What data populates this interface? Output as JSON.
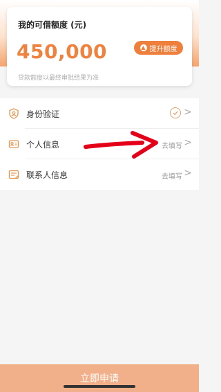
{
  "card": {
    "title": "我的可借额度 (元)",
    "amount": "450,000",
    "raise_button": "提升额度",
    "note": "贷款额度以最终审批结果为准"
  },
  "items": [
    {
      "label": "身份验证",
      "status": "",
      "completed": true,
      "icon": "shield-person-icon"
    },
    {
      "label": "个人信息",
      "status": "去填写",
      "completed": false,
      "icon": "id-card-icon"
    },
    {
      "label": "联系人信息",
      "status": "去填写",
      "completed": false,
      "icon": "contact-card-icon"
    }
  ],
  "footer": {
    "apply_button": "立即申请"
  },
  "colors": {
    "accent": "#ef7f3c",
    "amount": "#f0823f",
    "apply_bar": "#f2b08a",
    "annotation_arrow": "#e5001a"
  },
  "annotation": {
    "type": "arrow",
    "points_to": "个人信息 去填写"
  }
}
